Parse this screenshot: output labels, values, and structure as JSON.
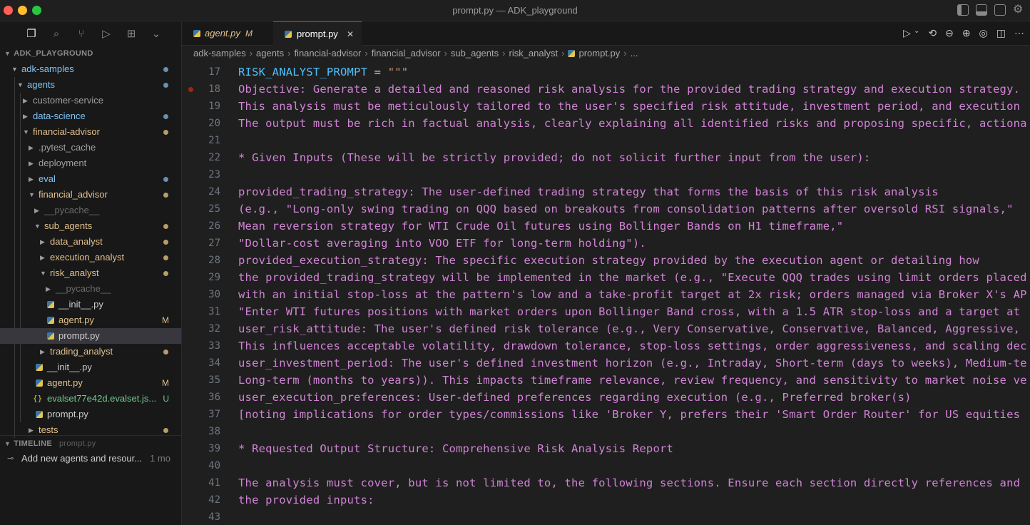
{
  "window": {
    "title": "prompt.py — ADK_playground"
  },
  "explorer": {
    "root": "ADK_PLAYGROUND",
    "timeline_label": "TIMELINE",
    "timeline_file": "prompt.py",
    "timeline_entry": "Add new agents and resour...",
    "timeline_age": "1 mo",
    "items": [
      {
        "label": "adk-samples",
        "color": "#7ec3f7",
        "status": "dot",
        "status_color": "#6b8fb0"
      },
      {
        "label": "agents",
        "color": "#7ec3f7",
        "status": "dot",
        "status_color": "#6b8fb0"
      },
      {
        "label": "customer-service",
        "color": "#a0a0a0",
        "status": ""
      },
      {
        "label": "data-science",
        "color": "#7ec3f7",
        "status": "dot",
        "status_color": "#6b8fb0"
      },
      {
        "label": "financial-advisor",
        "color": "#e2c08d",
        "status": "dot",
        "status_color": "#b89d6c"
      },
      {
        "label": ".pytest_cache",
        "color": "#a0a0a0",
        "status": ""
      },
      {
        "label": "deployment",
        "color": "#a0a0a0",
        "status": ""
      },
      {
        "label": "eval",
        "color": "#7ec3f7",
        "status": "dot",
        "status_color": "#6b8fb0"
      },
      {
        "label": "financial_advisor",
        "color": "#e2c08d",
        "status": "dot",
        "status_color": "#b89d6c"
      },
      {
        "label": "__pycache__",
        "color": "#6a6a6a",
        "status": ""
      },
      {
        "label": "sub_agents",
        "color": "#e2c08d",
        "status": "dot",
        "status_color": "#b89d6c"
      },
      {
        "label": "data_analyst",
        "color": "#e2c08d",
        "status": "dot",
        "status_color": "#b89d6c"
      },
      {
        "label": "execution_analyst",
        "color": "#e2c08d",
        "status": "dot",
        "status_color": "#b89d6c"
      },
      {
        "label": "risk_analyst",
        "color": "#e2c08d",
        "status": "dot",
        "status_color": "#b89d6c"
      },
      {
        "label": "__pycache__",
        "color": "#6a6a6a",
        "status": ""
      },
      {
        "label": "__init__.py",
        "color": "#cccccc",
        "status": ""
      },
      {
        "label": "agent.py",
        "color": "#e2c08d",
        "status": "M",
        "status_color": "#e2c08d"
      },
      {
        "label": "prompt.py",
        "color": "#cccccc",
        "status": ""
      },
      {
        "label": "trading_analyst",
        "color": "#e2c08d",
        "status": "dot",
        "status_color": "#b89d6c"
      },
      {
        "label": "__init__.py",
        "color": "#cccccc",
        "status": ""
      },
      {
        "label": "agent.py",
        "color": "#e2c08d",
        "status": "M",
        "status_color": "#e2c08d"
      },
      {
        "label": "evalset77e42d.evalset.js...",
        "color": "#73c991",
        "status": "U",
        "status_color": "#73c991"
      },
      {
        "label": "prompt.py",
        "color": "#cccccc",
        "status": ""
      },
      {
        "label": "tests",
        "color": "#e2c08d",
        "status": "dot",
        "status_color": "#b89d6c"
      }
    ]
  },
  "tabs": [
    {
      "label": "agent.py",
      "badge": "M"
    },
    {
      "label": "prompt.py",
      "close": "✕"
    }
  ],
  "breadcrumb": [
    "adk-samples",
    "agents",
    "financial-advisor",
    "financial_advisor",
    "sub_agents",
    "risk_analyst",
    "prompt.py",
    "..."
  ],
  "editor": {
    "lines": [
      {
        "n": "17",
        "text": ""
      },
      {
        "n": "18",
        "text": "Objective: Generate a detailed and reasoned risk analysis for the provided trading strategy and execution strategy."
      },
      {
        "n": "19",
        "text": "This analysis must be meticulously tailored to the user's specified risk attitude, investment period, and execution"
      },
      {
        "n": "20",
        "text": "The output must be rich in factual analysis, clearly explaining all identified risks and proposing specific, actiona"
      },
      {
        "n": "21",
        "text": ""
      },
      {
        "n": "22",
        "text": "* Given Inputs (These will be strictly provided; do not solicit further input from the user):"
      },
      {
        "n": "23",
        "text": ""
      },
      {
        "n": "24",
        "text": "provided_trading_strategy: The user-defined trading strategy that forms the basis of this risk analysis"
      },
      {
        "n": "25",
        "text": "(e.g., \"Long-only swing trading on QQQ based on breakouts from consolidation patterns after oversold RSI signals,\""
      },
      {
        "n": "26",
        "text": "Mean reversion strategy for WTI Crude Oil futures using Bollinger Bands on H1 timeframe,\""
      },
      {
        "n": "27",
        "text": "\"Dollar-cost averaging into VOO ETF for long-term holding\")."
      },
      {
        "n": "28",
        "text": "provided_execution_strategy: The specific execution strategy provided by the execution agent or detailing how"
      },
      {
        "n": "29",
        "text": "the provided_trading_strategy will be implemented in the market (e.g., \"Execute QQQ trades using limit orders placed"
      },
      {
        "n": "30",
        "text": "with an initial stop-loss at the pattern's low and a take-profit target at 2x risk; orders managed via Broker X's AP"
      },
      {
        "n": "31",
        "text": "\"Enter WTI futures positions with market orders upon Bollinger Band cross, with a 1.5 ATR stop-loss and a target at"
      },
      {
        "n": "32",
        "text": "user_risk_attitude: The user's defined risk tolerance (e.g., Very Conservative, Conservative, Balanced, Aggressive,"
      },
      {
        "n": "33",
        "text": "This influences acceptable volatility, drawdown tolerance, stop-loss settings, order aggressiveness, and scaling dec"
      },
      {
        "n": "34",
        "text": "user_investment_period: The user's defined investment horizon (e.g., Intraday, Short-term (days to weeks), Medium-te"
      },
      {
        "n": "35",
        "text": "Long-term (months to years)). This impacts timeframe relevance, review frequency, and sensitivity to market noise ve"
      },
      {
        "n": "36",
        "text": "user_execution_preferences: User-defined preferences regarding execution (e.g., Preferred broker(s)"
      },
      {
        "n": "37",
        "text": "[noting implications for order types/commissions like 'Broker Y, prefers their 'Smart Order Router' for US equities"
      },
      {
        "n": "38",
        "text": ""
      },
      {
        "n": "39",
        "text": "* Requested Output Structure: Comprehensive Risk Analysis Report"
      },
      {
        "n": "40",
        "text": ""
      },
      {
        "n": "41",
        "text": "The analysis must cover, but is not limited to, the following sections. Ensure each section directly references and"
      },
      {
        "n": "42",
        "text": "the provided inputs:"
      },
      {
        "n": "43",
        "text": ""
      }
    ],
    "first_line_var": "RISK_ANALYST_PROMPT",
    "first_line_op": " = ",
    "first_line_str": "\"\"\""
  }
}
